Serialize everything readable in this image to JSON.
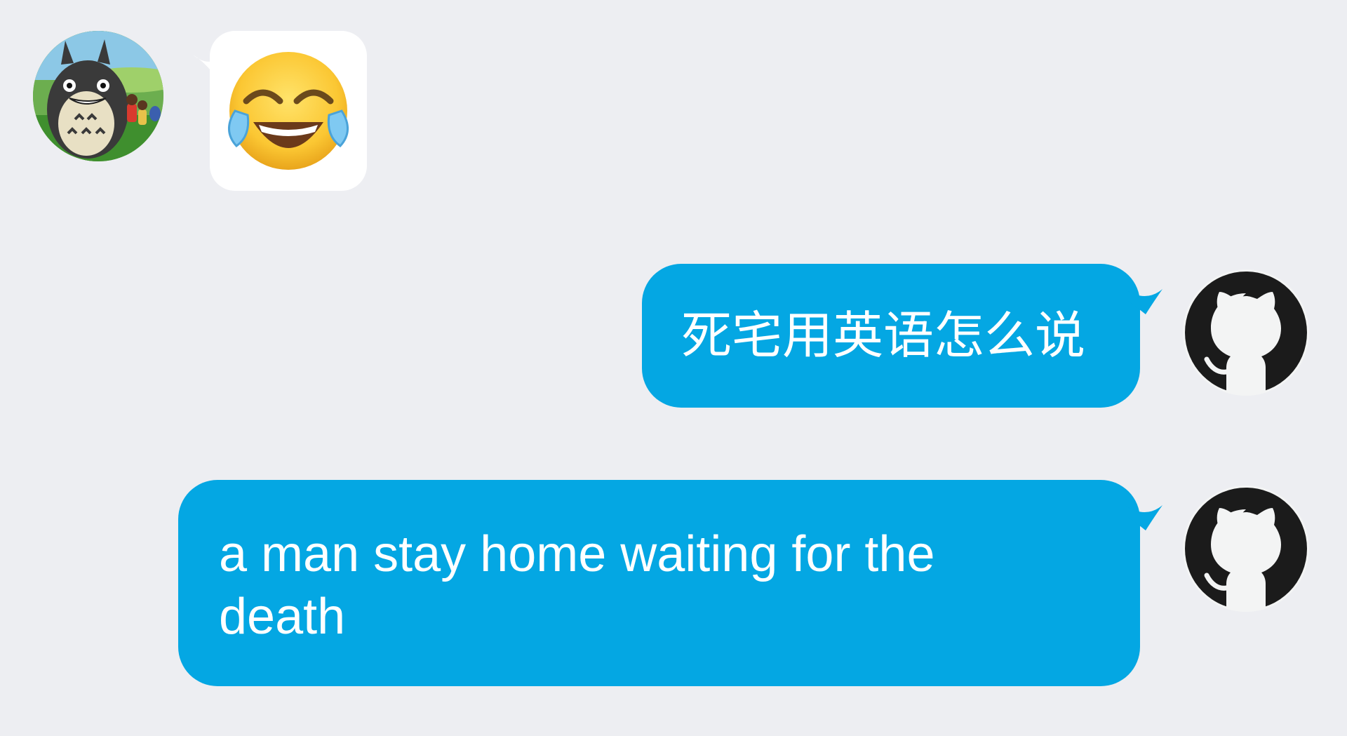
{
  "chat": {
    "contact_avatar_icon": "totoro-avatar-icon",
    "self_avatar_icon": "github-octocat-icon",
    "messages": [
      {
        "direction": "incoming",
        "type": "sticker",
        "sticker_icon": "laughing-crying-emoji-icon"
      },
      {
        "direction": "outgoing",
        "type": "text",
        "text": "死宅用英语怎么说"
      },
      {
        "direction": "outgoing",
        "type": "text",
        "text": "a man stay home waiting for the death"
      }
    ]
  },
  "colors": {
    "background": "#edeef2",
    "outgoing_bubble": "#04a7e3",
    "incoming_bubble": "#ffffff",
    "outgoing_text": "#ffffff"
  }
}
